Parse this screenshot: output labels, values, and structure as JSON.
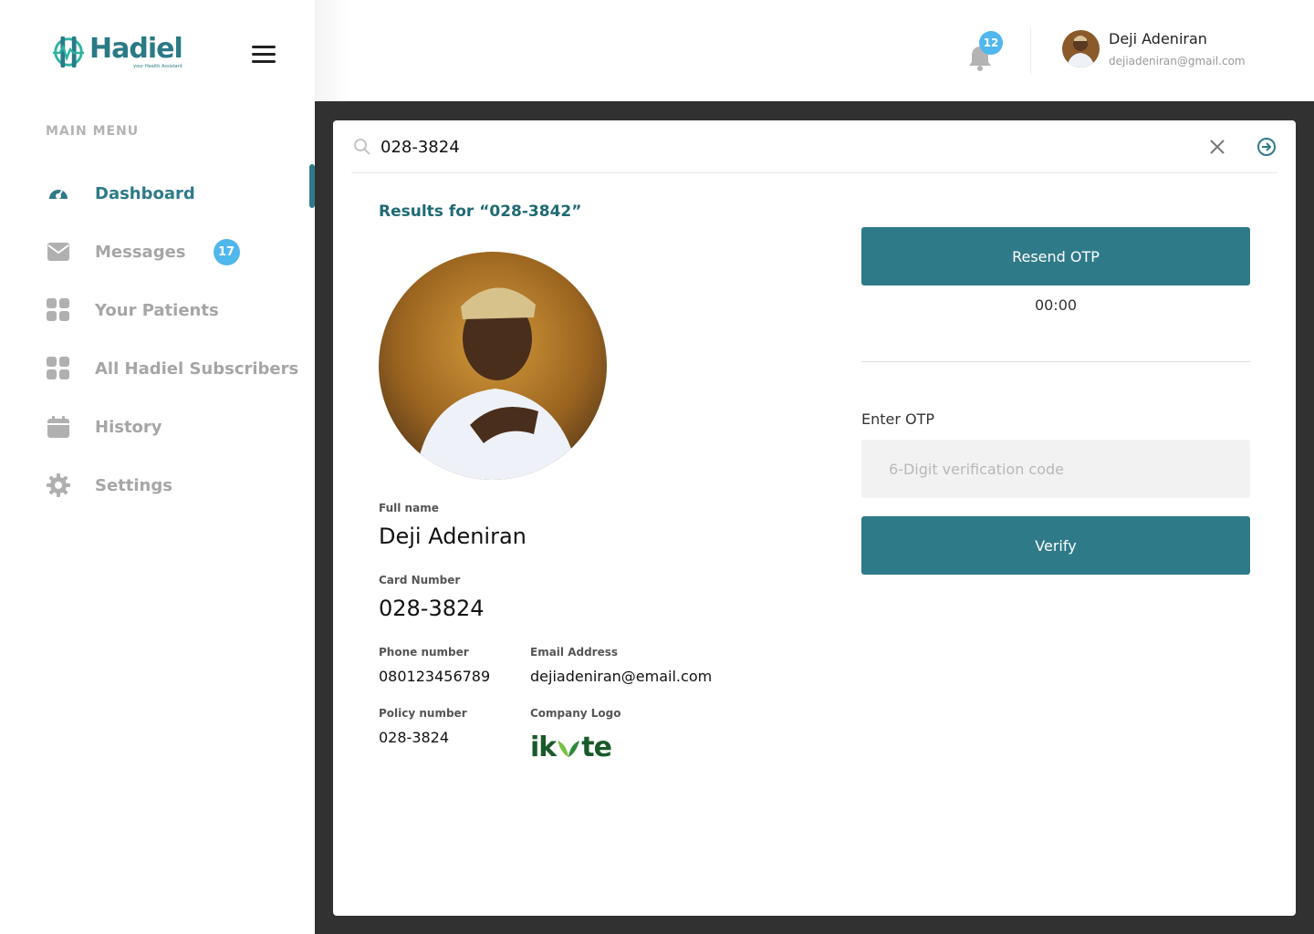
{
  "brand": {
    "name": "Hadiel",
    "tagline": "your Health Assistant",
    "color": "#2e7a88"
  },
  "sidebar": {
    "menu_title": "MAIN MENU",
    "items": [
      {
        "label": "Dashboard",
        "icon": "dashboard-gauge-icon",
        "active": true
      },
      {
        "label": "Messages",
        "icon": "envelope-icon",
        "badge": "17"
      },
      {
        "label": "Your Patients",
        "icon": "grid-icon"
      },
      {
        "label": "All Hadiel Subscribers",
        "icon": "grid-icon"
      },
      {
        "label": "History",
        "icon": "calendar-icon"
      },
      {
        "label": "Settings",
        "icon": "gear-icon"
      }
    ]
  },
  "header": {
    "notifications_count": "12",
    "user": {
      "name": "Deji Adeniran",
      "email": "dejiadeniran@gmail.com"
    }
  },
  "search": {
    "value": "028-3824"
  },
  "results": {
    "title": "Results for  “028-3842”",
    "full_name_label": "Full name",
    "full_name": "Deji Adeniran",
    "card_number_label": "Card Number",
    "card_number": "028-3824",
    "phone_label": "Phone number",
    "phone": "080123456789",
    "email_label": "Email Address",
    "email": "dejiadeniran@email.com",
    "policy_label": "Policy number",
    "policy": "028-3824",
    "company_logo_label": "Company Logo",
    "company_logo_text_left": "ik",
    "company_logo_text_right": "te"
  },
  "otp": {
    "resend_label": "Resend OTP",
    "timer": "00:00",
    "enter_label": "Enter OTP",
    "placeholder": "6-Digit verification code",
    "verify_label": "Verify"
  }
}
